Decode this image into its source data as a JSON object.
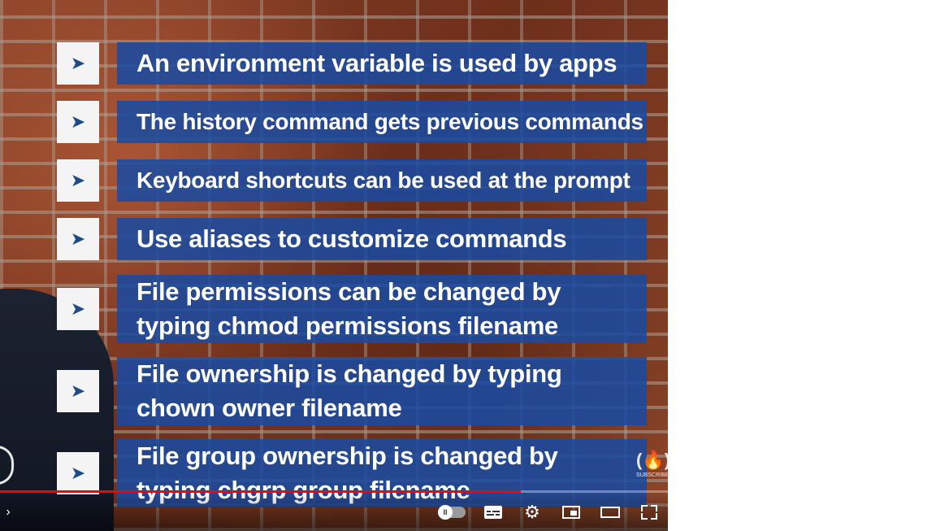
{
  "bullets": [
    {
      "lines": [
        "An environment variable is used by apps"
      ]
    },
    {
      "lines": [
        "The history command gets previous commands"
      ]
    },
    {
      "lines": [
        "Keyboard shortcuts can be used at the prompt"
      ]
    },
    {
      "lines": [
        "Use aliases to customize commands"
      ]
    },
    {
      "lines": [
        "File permissions can be changed by",
        "typing chmod permissions filename"
      ]
    },
    {
      "lines": [
        "File ownership is changed by typing",
        "chown owner filename"
      ]
    },
    {
      "lines": [
        "File group ownership is changed by",
        "typing chgrp group filename"
      ]
    }
  ],
  "bullet_glyph": "➤",
  "watermark": {
    "logo": "(🔥)",
    "label": "SUBSCRIBE"
  },
  "player": {
    "progress_fraction": 0.78,
    "chapter_chevron": "›",
    "settings_glyph": "⚙",
    "pause_glyph": "II"
  },
  "colors": {
    "bar": "#1a4aa0",
    "progress": "#ff0000"
  },
  "icons": [
    "chevron-right-icon",
    "autoplay-toggle-icon",
    "subtitles-icon",
    "settings-icon",
    "miniplayer-icon",
    "theater-mode-icon",
    "fullscreen-icon"
  ]
}
